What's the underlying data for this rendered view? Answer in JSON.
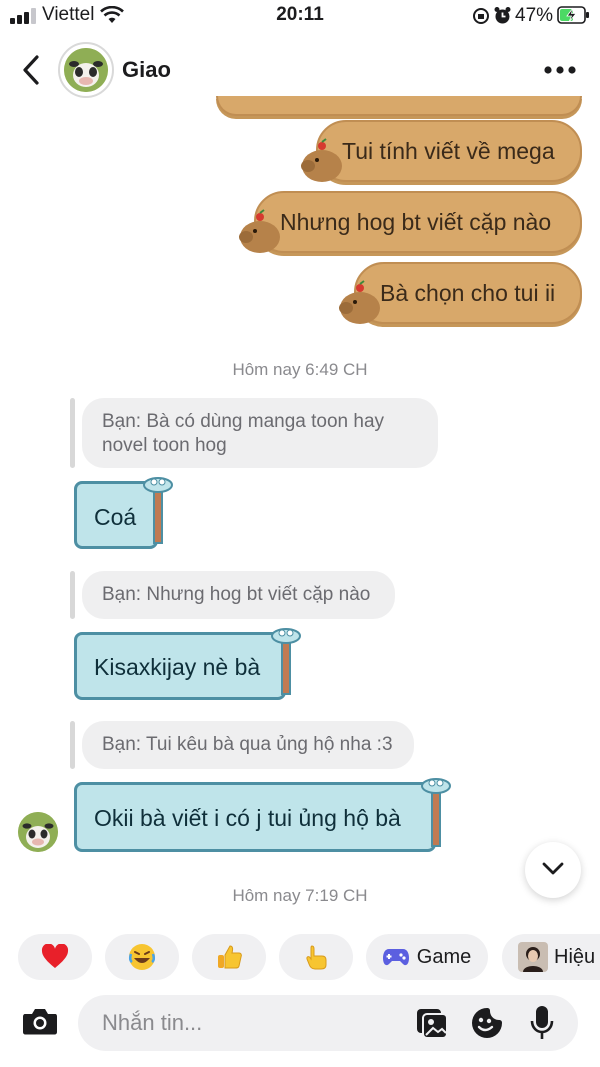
{
  "status_bar": {
    "carrier": "Viettel",
    "time": "20:11",
    "battery_percent": "47%"
  },
  "header": {
    "contact_name": "Giao",
    "back_icon": "chevron-left-icon",
    "more_icon": "more-horizontal-icon"
  },
  "sent_messages": [
    {
      "text": "Tui tính viết về mega"
    },
    {
      "text": "Nhưng hog bt viết cặp nào"
    },
    {
      "text": "Bà chọn cho tui ii"
    }
  ],
  "timestamps": {
    "first": "Hôm nay 6:49 CH",
    "second": "Hôm nay 7:19 CH"
  },
  "conversation": [
    {
      "quote": "Bạn: Bà có dùng manga toon hay novel toon hog",
      "reply": "Coá"
    },
    {
      "quote": "Bạn: Nhưng hog bt viết cặp nào",
      "reply": "Kisaxkijay nè bà"
    },
    {
      "quote": "Bạn: Tui kêu bà qua ủng hộ nha :3",
      "reply": "Okii bà viết i có j tui ủng hộ bà"
    }
  ],
  "quick_reactions": [
    {
      "emoji": "❤️",
      "icon": "heart-icon"
    },
    {
      "emoji": "😂",
      "icon": "laughing-icon"
    },
    {
      "emoji": "👍",
      "icon": "thumbs-up-icon"
    },
    {
      "emoji": "👆",
      "icon": "pointing-icon"
    }
  ],
  "quick_actions": {
    "game_label": "Game",
    "person_label": "Hiệu"
  },
  "composer": {
    "placeholder": "Nhắn tin..."
  },
  "colors": {
    "sent_bubble": "#d8a86a",
    "received_bubble": "#bfe4ea",
    "received_border": "#4d8fa3",
    "game_icon": "#5b5fe0"
  }
}
